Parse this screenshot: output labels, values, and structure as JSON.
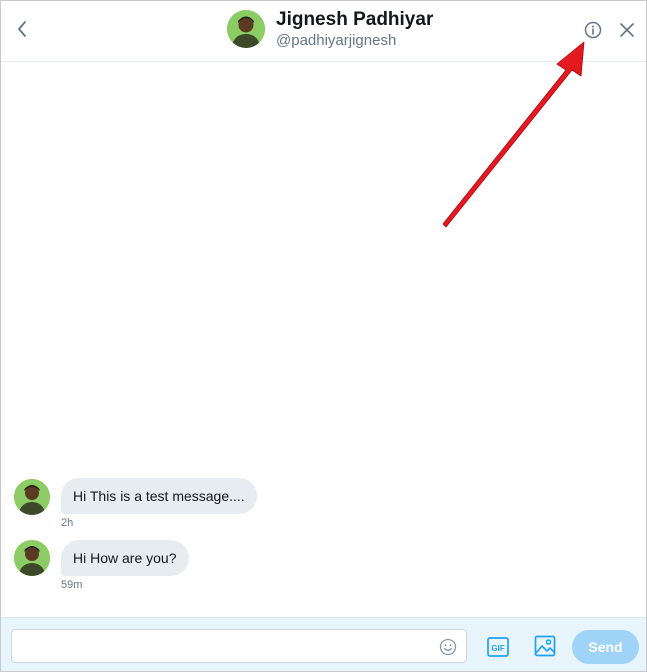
{
  "header": {
    "name": "Jignesh Padhiyar",
    "handle": "@padhiyarjignesh"
  },
  "messages": [
    {
      "text": "Hi This is a test message....",
      "time": "2h"
    },
    {
      "text": "Hi How are you?",
      "time": "59m"
    }
  ],
  "composer": {
    "placeholder": "",
    "value": "",
    "gif_label": "GIF",
    "send_label": "Send"
  },
  "icons": {
    "back": "chevron-left-icon",
    "info": "info-circle-icon",
    "close": "close-icon",
    "emoji": "smiley-icon",
    "gif": "gif-icon",
    "image": "image-icon",
    "annotation": "red-arrow"
  },
  "colors": {
    "accent": "#1da1f2",
    "send_disabled": "#9fd3f8",
    "bubble": "#e6ecf0",
    "composer_bg": "#e8f5fd",
    "arrow": "#e8121d"
  }
}
